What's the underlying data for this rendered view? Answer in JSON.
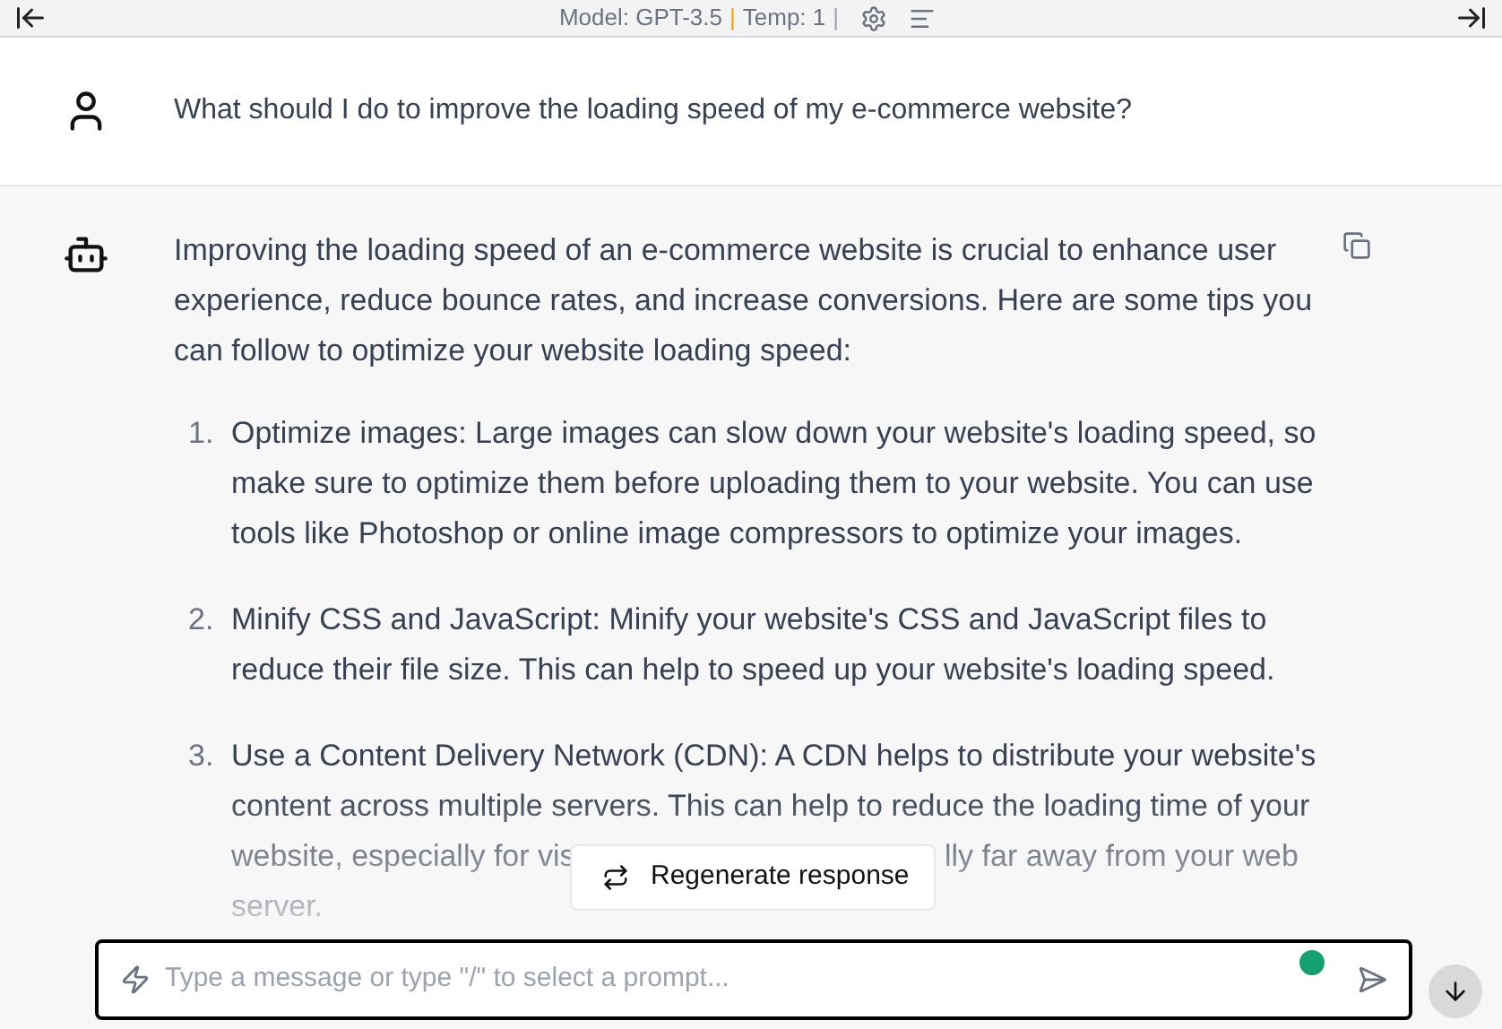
{
  "header": {
    "model": "Model: GPT-3.5",
    "separator_1": "|",
    "temp": "Temp: 1",
    "separator_2": "|"
  },
  "user_message": {
    "text": "What should I do to improve the loading speed of my e-commerce website?"
  },
  "assistant_message": {
    "intro_lines": [
      "Improving the loading speed of an e-commerce website is crucial to enhance user",
      "experience, reduce bounce rates, and increase conversions. Here are some tips you",
      "can follow to optimize your website loading speed:"
    ],
    "items": [
      {
        "number": "1.",
        "lines": [
          [
            "Optimize images: Large images can slow down your website's loading speed, so"
          ],
          [
            "make sure to optimize them before uploading them to your website. You can use"
          ],
          [
            "tools like Photoshop or online image compressors to optimize your images."
          ]
        ]
      },
      {
        "number": "2.",
        "lines": [
          [
            "Minify CSS and JavaScript: Minify your website's CSS and JavaScript files to"
          ],
          [
            "reduce their file size. This can help to speed up your website's loading speed."
          ]
        ]
      },
      {
        "number": "3.",
        "lines": [
          [
            "Use a Content Delivery Network (CDN): A CDN helps to distribute your website's"
          ],
          [
            "content across multiple servers. This can help to reduce the loading time of your"
          ],
          [
            "website, especially for vis",
            "lly far away from your web"
          ],
          [
            "server."
          ]
        ]
      }
    ]
  },
  "regenerate_button": {
    "label": "Regenerate response"
  },
  "input": {
    "placeholder": "Type a message or type \"/\" to select a prompt..."
  }
}
